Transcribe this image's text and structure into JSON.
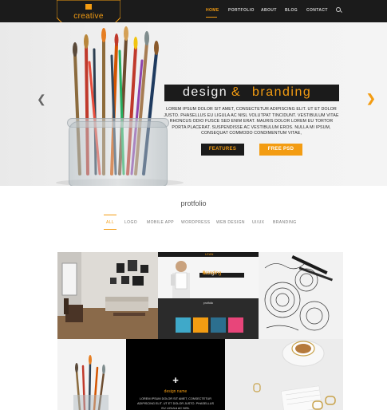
{
  "logo": {
    "text": "creative"
  },
  "nav": {
    "items": [
      {
        "label": "HOME",
        "active": true
      },
      {
        "label": "PORTFOLIO"
      },
      {
        "label": "ABOUT"
      },
      {
        "label": "BLOG"
      },
      {
        "label": "CONTACT"
      }
    ],
    "search_icon": "search-icon"
  },
  "hero": {
    "heading_word1": "design",
    "heading_amp": "&",
    "heading_word2": "branding",
    "body": "LOREM IPSUM DOLOR SIT AMET, CONSECTETUR ADIPISCING ELIT. UT ET DOLOR JUSTO. PHASELLUS EU LIGULA AC NISL VOLUTPAT TINCIDUNT. VESTIBULUM VITAE RHONCUS ODIO FUSCE SED ENIM ERAT. MAURIS DOLOR LOREM EU TORTOR PORTA PLACERAT. SUSPENDISSE AC VESTIBULUM EROS. NULLA MI IPSUM, CONSEQUAT COMMODO CONDIMENTUM VITAE,",
    "btn_features": "FEATURES",
    "btn_free": "FREE PSD",
    "prev_icon": "chevron-left-icon",
    "next_icon": "chevron-right-icon"
  },
  "portfolio": {
    "title": "protfolio",
    "filters": [
      "ALL",
      "LOGO",
      "MOBILE APP",
      "WORDPRESS",
      "WEB DESIGN",
      "UI/UX",
      "BRANDING"
    ],
    "active_filter": "ALL",
    "tile2": {
      "lean": "LEAN",
      "banner_word1": "design",
      "banner_amp": "&",
      "banner_word2": "branding",
      "sub": "protfolio"
    },
    "tile5": {
      "plus": "+",
      "name": "design name",
      "text": "LOREM IPSUM DOLOR SIT AMET, CONSECTETUR ADIPISCING ELIT. UT ET DOLOR JUSTO. PHASELLUS EU LIGULA AC NISL"
    }
  },
  "colors": {
    "accent": "#f39c12",
    "dark": "#1b1b1b"
  }
}
